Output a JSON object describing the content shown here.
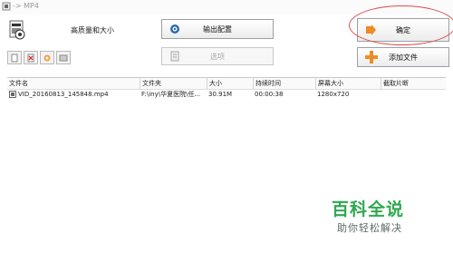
{
  "window": {
    "title": "-> MP4"
  },
  "quality": {
    "label": "高质量和大小"
  },
  "buttons": {
    "output_config": "输出配置",
    "ok": "确定",
    "options": "选项",
    "add_file": "添加文件"
  },
  "table": {
    "headers": [
      "文件名",
      "文件夹",
      "大小",
      "持续时间",
      "屏幕大小",
      "截取片断"
    ],
    "rows": [
      {
        "filename": "VID_20160813_145848.mp4",
        "folder": "F:\\iny\\华夏医院\\任...",
        "size": "30.91M",
        "duration": "00:00:38",
        "screen": "1280x720",
        "clip": ""
      }
    ]
  },
  "watermark": {
    "title": "百科全说",
    "subtitle": "助你轻松解决"
  },
  "colors": {
    "accent": "#2fa84f",
    "highlight": "#e04a4a",
    "ok_icon": "#f08a24"
  },
  "icons": [
    "video-file-icon",
    "gear-icon",
    "arrow-right-icon",
    "options-icon",
    "plus-icon"
  ]
}
